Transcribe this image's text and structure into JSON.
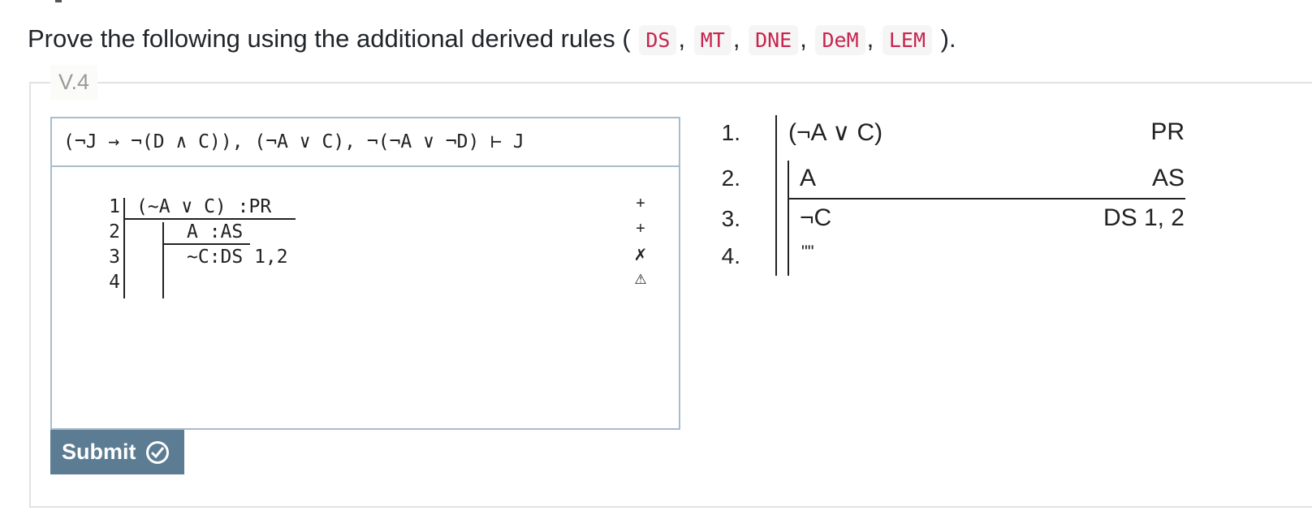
{
  "instructions": {
    "prefix": "Prove the following using the additional derived rules (",
    "suffix": ").",
    "separator": ",",
    "rules": [
      "DS",
      "MT",
      "DNE",
      "DeM",
      "LEM"
    ]
  },
  "exercise": {
    "legend": "V.4",
    "sequent": "(¬J → ¬(D ∧ C)), (¬A ∨ C), ¬(¬A ∨ ¬D) ⊢ J"
  },
  "editor": {
    "line_numbers": [
      "1",
      "2",
      "3",
      "4"
    ],
    "lines": [
      "(~A ∨ C) :PR",
      "A :AS",
      "~C:DS 1,2",
      ""
    ],
    "status_markers": [
      "+",
      "+",
      "✗",
      "⚠"
    ]
  },
  "submit": {
    "label": "Submit"
  },
  "rendered_proof": {
    "lines": [
      {
        "num": "1.",
        "formula": "(¬A ∨ C)",
        "justification": "PR"
      },
      {
        "num": "2.",
        "formula": "A",
        "justification": "AS"
      },
      {
        "num": "3.",
        "formula": "¬C",
        "justification": "DS 1, 2"
      },
      {
        "num": "4.",
        "formula": "\"\"",
        "justification": ""
      }
    ]
  },
  "icons": {
    "submit": "check-circle-icon",
    "error": "cross-icon",
    "warning": "warning-icon",
    "ok": "plus-icon"
  }
}
